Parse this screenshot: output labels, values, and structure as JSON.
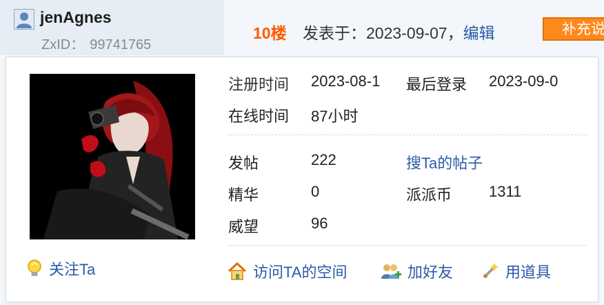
{
  "user": {
    "username": "jenAgnes",
    "zxid_label": "ZxID：",
    "zxid": "99741765"
  },
  "post": {
    "floor": "10楼",
    "posted_prefix": "发表于：2023-09-07，",
    "edit_label": "编辑",
    "supplement_label": "补充说"
  },
  "profile": {
    "reg_label": "注册时间",
    "reg_value": "2023-08-1",
    "last_login_label": "最后登录",
    "last_login_value": "2023-09-0",
    "online_label": "在线时间",
    "online_value": "87小时",
    "posts_label": "发帖",
    "posts_value": "222",
    "search_posts": "搜Ta的帖子",
    "elite_label": "精华",
    "elite_value": "0",
    "coin_label": "派派币",
    "coin_value": "1311",
    "prestige_label": "威望",
    "prestige_value": "96"
  },
  "actions": {
    "follow": "关注Ta",
    "visit_space": "访问TA的空间",
    "add_friend": "加好友",
    "use_item": "用道具"
  },
  "icons": {
    "user": "user-avatar-icon",
    "bulb": "bulb-icon",
    "home": "home-icon",
    "friends": "add-friend-icon",
    "wand": "magic-wand-icon"
  },
  "colors": {
    "accent_orange": "#ff5a00",
    "link_blue": "#2a5aa8",
    "button_orange": "#ff8a1c"
  }
}
